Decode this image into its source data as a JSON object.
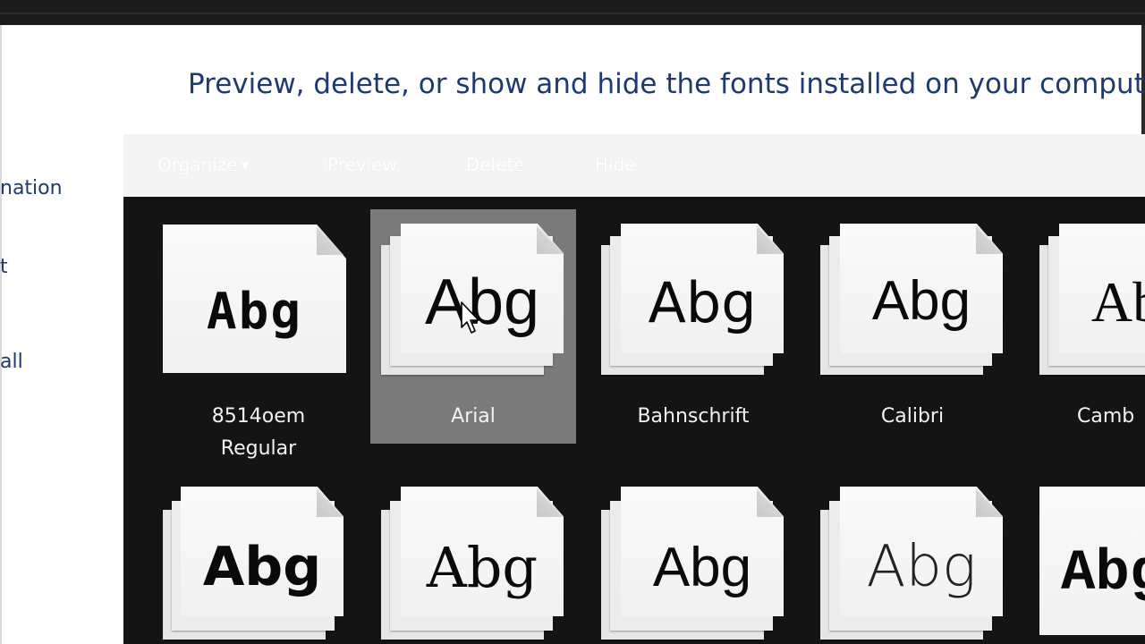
{
  "sidebar": {
    "links": [
      "nation",
      "t",
      "all"
    ]
  },
  "page": {
    "heading": "Preview, delete, or show and hide the fonts installed on your computer"
  },
  "toolbar": {
    "organize": "Organize",
    "preview": "Preview",
    "delete": "Delete",
    "hide": "Hide"
  },
  "fonts": {
    "sample": "Abg",
    "row1": [
      {
        "name_line1": "8514oem",
        "name_line2": "Regular",
        "family": false,
        "selected": false
      },
      {
        "name_line1": "Arial",
        "name_line2": "",
        "family": true,
        "selected": true
      },
      {
        "name_line1": "Bahnschrift",
        "name_line2": "",
        "family": true,
        "selected": false
      },
      {
        "name_line1": "Calibri",
        "name_line2": "",
        "family": true,
        "selected": false
      },
      {
        "name_line1": "Camb",
        "name_line2": "",
        "family": true,
        "selected": false
      }
    ]
  },
  "colors": {
    "heading": "#1e3a6e",
    "grid_background": "#141414",
    "selection": "#7a7a7a"
  }
}
